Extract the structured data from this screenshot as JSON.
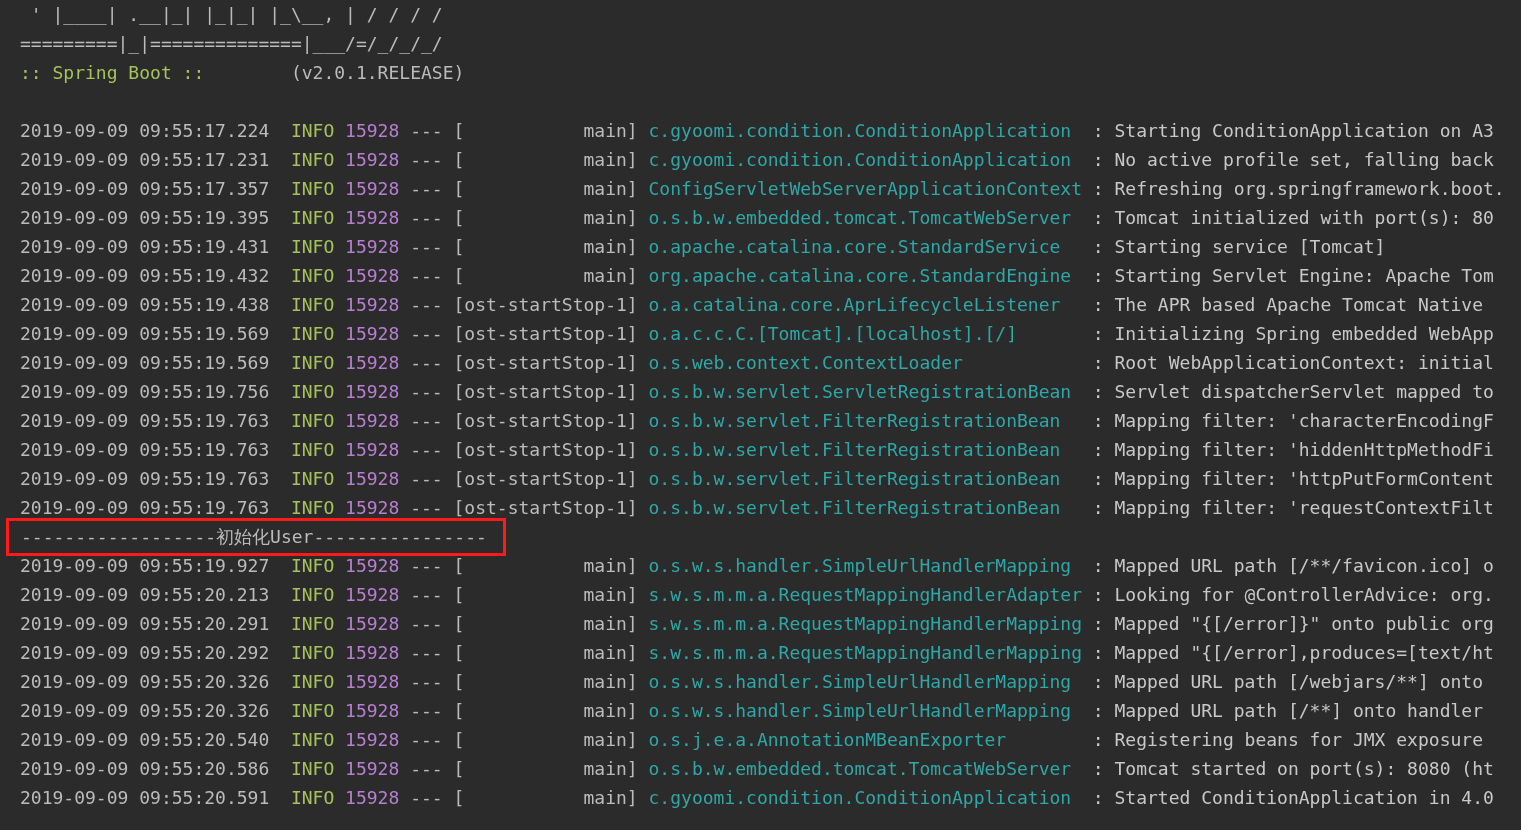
{
  "banner": [
    " ' |____| .__|_| |_|_| |_\\__, | / / / /",
    "=========|_|==============|___/=/_/_/_/"
  ],
  "spring_boot": {
    "label": ":: Spring Boot ::",
    "version": "(v2.0.1.RELEASE)"
  },
  "lines": [
    {
      "kind": "log",
      "time": "2019-09-09 09:55:17.224",
      "level": "INFO",
      "pid": "15928",
      "sep": "---",
      "thread": "[           main]",
      "logger": "c.gyoomi.condition.ConditionApplication",
      "message": ": Starting ConditionApplication on A3"
    },
    {
      "kind": "log",
      "time": "2019-09-09 09:55:17.231",
      "level": "INFO",
      "pid": "15928",
      "sep": "---",
      "thread": "[           main]",
      "logger": "c.gyoomi.condition.ConditionApplication",
      "message": ": No active profile set, falling back"
    },
    {
      "kind": "log",
      "time": "2019-09-09 09:55:17.357",
      "level": "INFO",
      "pid": "15928",
      "sep": "---",
      "thread": "[           main]",
      "logger": "ConfigServletWebServerApplicationContext",
      "message": ": Refreshing org.springframework.boot."
    },
    {
      "kind": "log",
      "time": "2019-09-09 09:55:19.395",
      "level": "INFO",
      "pid": "15928",
      "sep": "---",
      "thread": "[           main]",
      "logger": "o.s.b.w.embedded.tomcat.TomcatWebServer",
      "message": ": Tomcat initialized with port(s): 80"
    },
    {
      "kind": "log",
      "time": "2019-09-09 09:55:19.431",
      "level": "INFO",
      "pid": "15928",
      "sep": "---",
      "thread": "[           main]",
      "logger": "o.apache.catalina.core.StandardService",
      "message": ": Starting service [Tomcat]"
    },
    {
      "kind": "log",
      "time": "2019-09-09 09:55:19.432",
      "level": "INFO",
      "pid": "15928",
      "sep": "---",
      "thread": "[           main]",
      "logger": "org.apache.catalina.core.StandardEngine",
      "message": ": Starting Servlet Engine: Apache Tom"
    },
    {
      "kind": "log",
      "time": "2019-09-09 09:55:19.438",
      "level": "INFO",
      "pid": "15928",
      "sep": "---",
      "thread": "[ost-startStop-1]",
      "logger": "o.a.catalina.core.AprLifecycleListener",
      "message": ": The APR based Apache Tomcat Native"
    },
    {
      "kind": "log",
      "time": "2019-09-09 09:55:19.569",
      "level": "INFO",
      "pid": "15928",
      "sep": "---",
      "thread": "[ost-startStop-1]",
      "logger": "o.a.c.c.C.[Tomcat].[localhost].[/]",
      "message": ": Initializing Spring embedded WebApp"
    },
    {
      "kind": "log",
      "time": "2019-09-09 09:55:19.569",
      "level": "INFO",
      "pid": "15928",
      "sep": "---",
      "thread": "[ost-startStop-1]",
      "logger": "o.s.web.context.ContextLoader",
      "message": ": Root WebApplicationContext: initial"
    },
    {
      "kind": "log",
      "time": "2019-09-09 09:55:19.756",
      "level": "INFO",
      "pid": "15928",
      "sep": "---",
      "thread": "[ost-startStop-1]",
      "logger": "o.s.b.w.servlet.ServletRegistrationBean",
      "message": ": Servlet dispatcherServlet mapped to"
    },
    {
      "kind": "log",
      "time": "2019-09-09 09:55:19.763",
      "level": "INFO",
      "pid": "15928",
      "sep": "---",
      "thread": "[ost-startStop-1]",
      "logger": "o.s.b.w.servlet.FilterRegistrationBean",
      "message": ": Mapping filter: 'characterEncodingF"
    },
    {
      "kind": "log",
      "time": "2019-09-09 09:55:19.763",
      "level": "INFO",
      "pid": "15928",
      "sep": "---",
      "thread": "[ost-startStop-1]",
      "logger": "o.s.b.w.servlet.FilterRegistrationBean",
      "message": ": Mapping filter: 'hiddenHttpMethodFi"
    },
    {
      "kind": "log",
      "time": "2019-09-09 09:55:19.763",
      "level": "INFO",
      "pid": "15928",
      "sep": "---",
      "thread": "[ost-startStop-1]",
      "logger": "o.s.b.w.servlet.FilterRegistrationBean",
      "message": ": Mapping filter: 'httpPutFormContent"
    },
    {
      "kind": "log",
      "time": "2019-09-09 09:55:19.763",
      "level": "INFO",
      "pid": "15928",
      "sep": "---",
      "thread": "[ost-startStop-1]",
      "logger": "o.s.b.w.servlet.FilterRegistrationBean",
      "message": ": Mapping filter: 'requestContextFilt"
    },
    {
      "kind": "plain",
      "text": "------------------初始化User----------------",
      "highlighted": true
    },
    {
      "kind": "log",
      "time": "2019-09-09 09:55:19.927",
      "level": "INFO",
      "pid": "15928",
      "sep": "---",
      "thread": "[           main]",
      "logger": "o.s.w.s.handler.SimpleUrlHandlerMapping",
      "message": ": Mapped URL path [/**/favicon.ico] o"
    },
    {
      "kind": "log",
      "time": "2019-09-09 09:55:20.213",
      "level": "INFO",
      "pid": "15928",
      "sep": "---",
      "thread": "[           main]",
      "logger": "s.w.s.m.m.a.RequestMappingHandlerAdapter",
      "message": ": Looking for @ControllerAdvice: org."
    },
    {
      "kind": "log",
      "time": "2019-09-09 09:55:20.291",
      "level": "INFO",
      "pid": "15928",
      "sep": "---",
      "thread": "[           main]",
      "logger": "s.w.s.m.m.a.RequestMappingHandlerMapping",
      "message": ": Mapped \"{[/error]}\" onto public org"
    },
    {
      "kind": "log",
      "time": "2019-09-09 09:55:20.292",
      "level": "INFO",
      "pid": "15928",
      "sep": "---",
      "thread": "[           main]",
      "logger": "s.w.s.m.m.a.RequestMappingHandlerMapping",
      "message": ": Mapped \"{[/error],produces=[text/ht"
    },
    {
      "kind": "log",
      "time": "2019-09-09 09:55:20.326",
      "level": "INFO",
      "pid": "15928",
      "sep": "---",
      "thread": "[           main]",
      "logger": "o.s.w.s.handler.SimpleUrlHandlerMapping",
      "message": ": Mapped URL path [/webjars/**] onto"
    },
    {
      "kind": "log",
      "time": "2019-09-09 09:55:20.326",
      "level": "INFO",
      "pid": "15928",
      "sep": "---",
      "thread": "[           main]",
      "logger": "o.s.w.s.handler.SimpleUrlHandlerMapping",
      "message": ": Mapped URL path [/**] onto handler"
    },
    {
      "kind": "log",
      "time": "2019-09-09 09:55:20.540",
      "level": "INFO",
      "pid": "15928",
      "sep": "---",
      "thread": "[           main]",
      "logger": "o.s.j.e.a.AnnotationMBeanExporter",
      "message": ": Registering beans for JMX exposure"
    },
    {
      "kind": "log",
      "time": "2019-09-09 09:55:20.586",
      "level": "INFO",
      "pid": "15928",
      "sep": "---",
      "thread": "[           main]",
      "logger": "o.s.b.w.embedded.tomcat.TomcatWebServer",
      "message": ": Tomcat started on port(s): 8080 (ht"
    },
    {
      "kind": "log",
      "time": "2019-09-09 09:55:20.591",
      "level": "INFO",
      "pid": "15928",
      "sep": "---",
      "thread": "[           main]",
      "logger": "c.gyoomi.condition.ConditionApplication",
      "message": ": Started ConditionApplication in 4.0"
    }
  ]
}
